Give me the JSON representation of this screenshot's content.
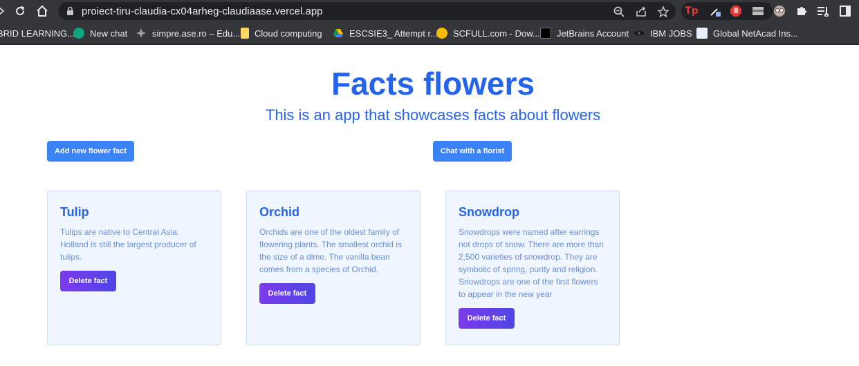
{
  "browser": {
    "url": "proiect-tiru-claudia-cx04arheg-claudiaase.vercel.app",
    "bookmarks": [
      {
        "label": "BRID LEARNING...",
        "icon": "bookmark-icon"
      },
      {
        "label": "New chat",
        "icon": "chatgpt-icon"
      },
      {
        "label": "simpre.ase.ro – Edu...",
        "icon": "star-shape-icon"
      },
      {
        "label": "Cloud computing",
        "icon": "folder-icon"
      },
      {
        "label": "ESCSIE3_ Attempt r...",
        "icon": "drive-icon"
      },
      {
        "label": "SCFULL.com - Dow...",
        "icon": "lightning-icon"
      },
      {
        "label": "JetBrains Account",
        "icon": "jetbrains-icon"
      },
      {
        "label": "IBM JOBS",
        "icon": "ibm-icon"
      },
      {
        "label": "Global NetAcad Ins...",
        "icon": "cisco-icon"
      }
    ]
  },
  "page": {
    "title": "Facts flowers",
    "subtitle": "This is an app that showcases facts about flowers",
    "add_button": "Add new flower fact",
    "chat_button": "Chat with a florist"
  },
  "cards": [
    {
      "title": "Tulip",
      "text": "Tulips are native to Central Asia. Holland is still the largest producer of tulips.",
      "button": "Delete fact"
    },
    {
      "title": "Orchid",
      "text": "Orchids are one of the oldest family of flowering plants. The smallest orchid is the size of a dime. The vanilla bean comes from a species of Orchid.",
      "button": "Delete fact"
    },
    {
      "title": "Snowdrop",
      "text": "Snowdrops were named after earrings not drops of snow. There are more than 2,500 varieties of snowdrop. They are symbolic of spring, purity and religion. Snowdrops are one of the first flowers to appear in the new year",
      "button": "Delete fact"
    }
  ],
  "colors": {
    "accent": "#2563eb",
    "button_blue": "#3b82f6",
    "delete_gradient_start": "#7c3aed",
    "delete_gradient_end": "#4f46e5",
    "card_bg": "#eff6ff"
  }
}
